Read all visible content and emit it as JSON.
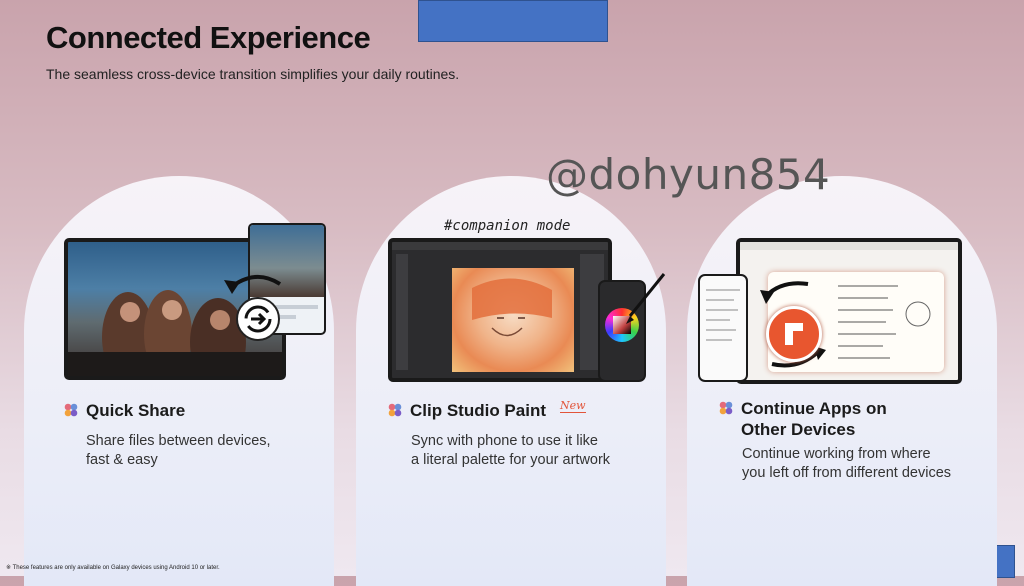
{
  "header": {
    "title": "Connected Experience",
    "subtitle": "The seamless cross-device transition simplifies your daily routines."
  },
  "watermark": "@dohyun854",
  "cards": [
    {
      "title": "Quick Share",
      "description_line1": "Share files between devices,",
      "description_line2": "fast & easy"
    },
    {
      "title": "Clip Studio Paint",
      "badge": "New",
      "annotation": "#companion mode",
      "description_line1": "Sync with phone to use it like",
      "description_line2": "a literal palette for your artwork"
    },
    {
      "title_line1": "Continue Apps on",
      "title_line2": "Other Devices",
      "description_line1": "Continue working from where",
      "description_line2": "you left off from different devices"
    }
  ],
  "footnote": "※ These features are only available on Galaxy devices using Android 10 or later.",
  "colors": {
    "accent_blue": "#4472c4",
    "new_badge": "#e2543a",
    "continue_icon": "#e8562f"
  }
}
